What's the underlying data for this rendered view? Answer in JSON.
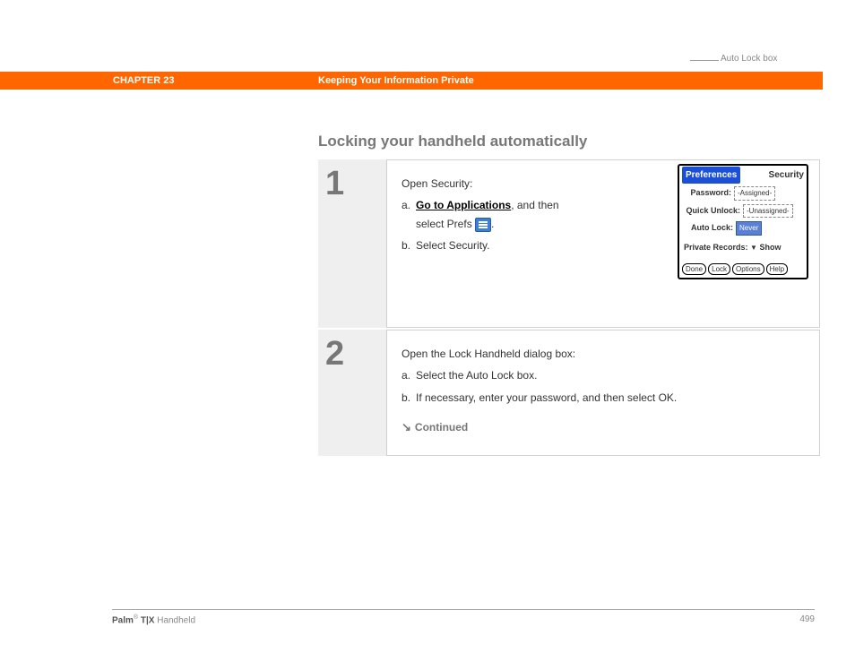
{
  "header": {
    "chapter": "CHAPTER 23",
    "topic": "Keeping Your Information Private"
  },
  "heading": "Locking your handheld automatically",
  "step1": {
    "num": "1",
    "intro": "Open Security:",
    "a_letter": "a.",
    "a_link": "Go to Applications",
    "a_rest1": ", and then",
    "a_rest2": "select Prefs ",
    "a_period": ".",
    "b_letter": "b.",
    "b_text": "Select Security."
  },
  "palm": {
    "pref": "Preferences",
    "sec": "Security",
    "password_lbl": "Password:",
    "password_val": "-Assigned-",
    "quick_lbl": "Quick Unlock:",
    "quick_val": "-Unassigned-",
    "auto_lbl": "Auto Lock:",
    "auto_val": "Never",
    "priv_lbl": "Private Records:",
    "priv_val": "Show",
    "btn_done": "Done",
    "btn_lock": "Lock",
    "btn_options": "Options",
    "btn_help": "Help"
  },
  "callout": "Auto Lock box",
  "step2": {
    "num": "2",
    "intro": "Open the Lock Handheld dialog box:",
    "a_letter": "a.",
    "a_text": "Select the Auto Lock box.",
    "b_letter": "b.",
    "b_text": "If necessary, enter your password, and then select OK.",
    "continued": "Continued"
  },
  "footer": {
    "brand": "Palm",
    "reg": "®",
    "model": " T|X",
    "device": " Handheld",
    "page": "499"
  }
}
